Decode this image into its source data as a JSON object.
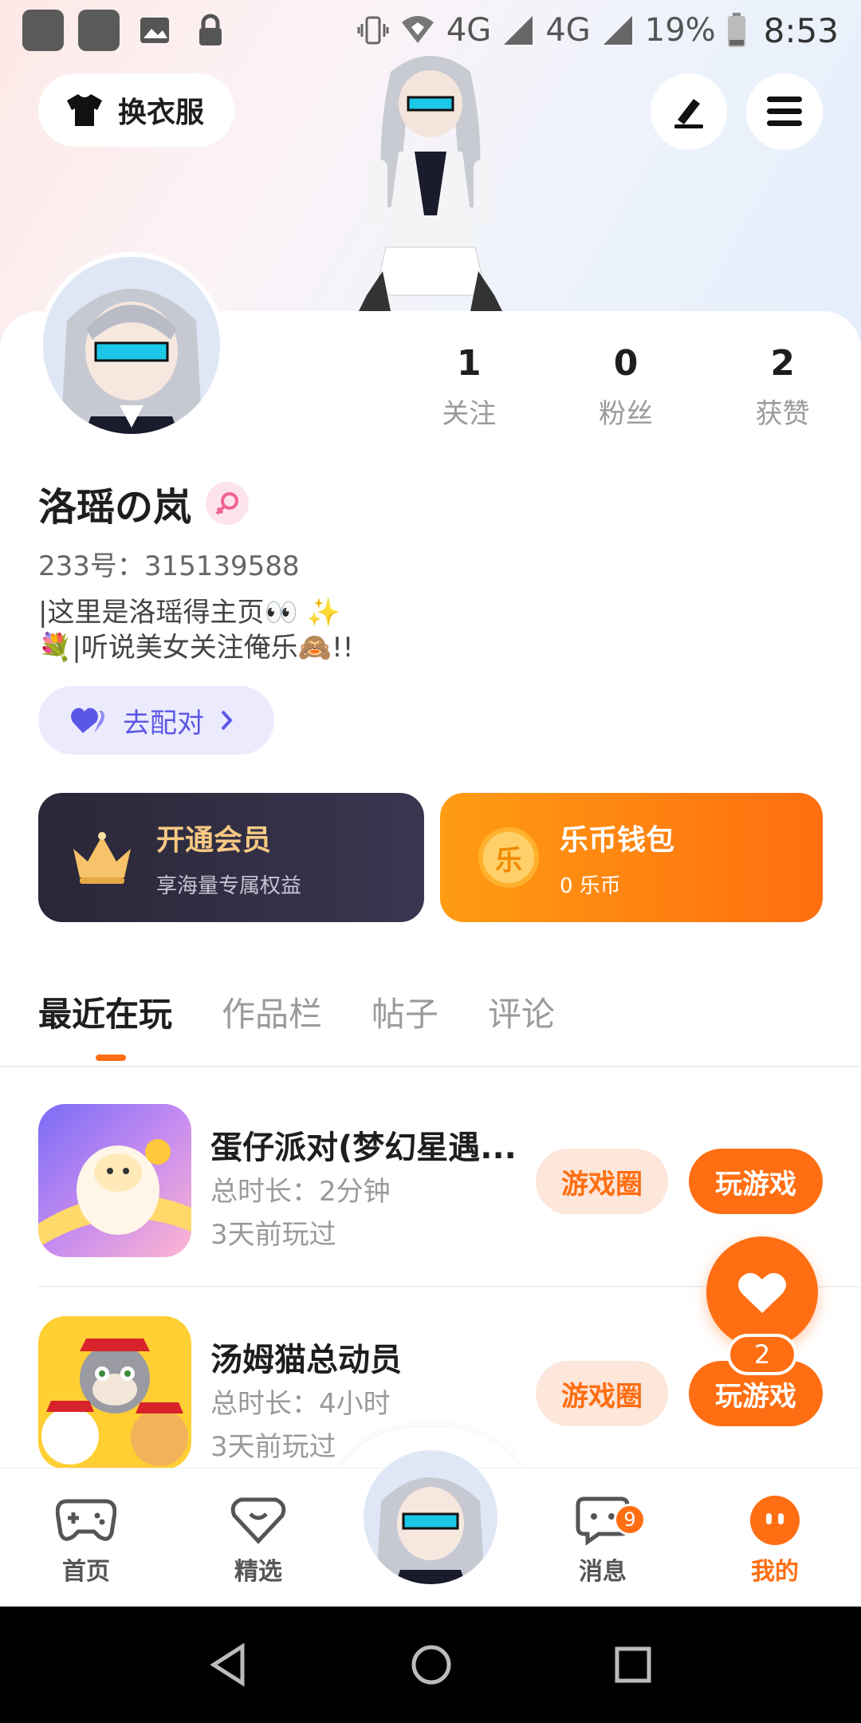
{
  "status_bar": {
    "network_1": "4G",
    "network_2": "4G",
    "battery": "19%",
    "time": "8:53"
  },
  "header": {
    "outfit_label": "换衣服"
  },
  "profile": {
    "stats": [
      {
        "value": "1",
        "label": "关注"
      },
      {
        "value": "0",
        "label": "粉丝"
      },
      {
        "value": "2",
        "label": "获赞"
      }
    ],
    "name": "洛瑶の岚",
    "id_text": "233号：315139588",
    "bio_line1": "|这里是洛瑶得主页👀 ✨",
    "bio_line2": "💐|听说美女关注俺乐🙈!!",
    "pair_label": "去配对"
  },
  "promo": {
    "vip_title": "开通会员",
    "vip_sub": "享海量专属权益",
    "wallet_title": "乐币钱包",
    "wallet_sub": "0 乐币",
    "coin_char": "乐"
  },
  "tabs": [
    "最近在玩",
    "作品栏",
    "帖子",
    "评论"
  ],
  "games": [
    {
      "name": "蛋仔派对(梦幻星遇...",
      "duration": "总时长：2分钟",
      "last": "3天前玩过",
      "circle_label": "游戏圈",
      "play_label": "玩游戏"
    },
    {
      "name": "汤姆猫总动员",
      "duration": "总时长：4小时",
      "last": "3天前玩过",
      "circle_label": "游戏圈",
      "play_label": "玩游戏"
    }
  ],
  "fab": {
    "count": "2"
  },
  "bottom_nav": {
    "home": "首页",
    "pick": "精选",
    "messages": "消息",
    "messages_badge": "9",
    "me": "我的"
  },
  "colors": {
    "accent": "#ff6e12",
    "vip_gold": "#f7c983",
    "pair_purple": "#5b57e6"
  }
}
